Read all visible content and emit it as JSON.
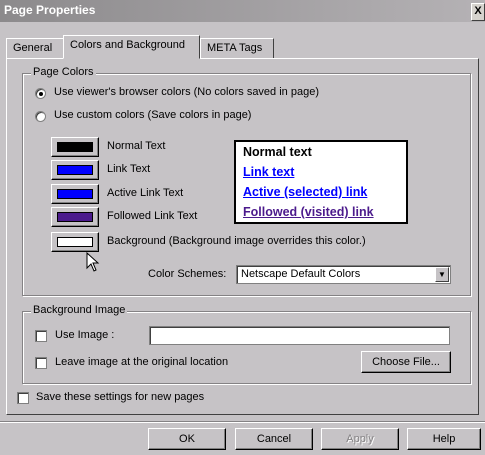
{
  "window": {
    "title": "Page Properties",
    "close_glyph": "X"
  },
  "tabs": [
    {
      "label": "General"
    },
    {
      "label": "Colors and Background"
    },
    {
      "label": "META Tags"
    }
  ],
  "page_colors": {
    "legend": "Page Colors",
    "option_browser": "Use viewer's browser colors (No colors saved in page)",
    "option_custom": "Use custom colors (Save colors in page)",
    "selected_option": "option_browser",
    "swatches": [
      {
        "label": "Normal Text",
        "color": "#000000"
      },
      {
        "label": "Link Text",
        "color": "#0000ff"
      },
      {
        "label": "Active Link Text",
        "color": "#0000ff"
      },
      {
        "label": "Followed Link Text",
        "color": "#4b1a8c"
      },
      {
        "label": "Background (Background image overrides this color.)",
        "color": "#ffffff"
      }
    ],
    "preview": {
      "normal": "Normal text",
      "link": "Link text",
      "active": "Active (selected) link",
      "followed": "Followed (visited) link"
    },
    "schemes_label": "Color Schemes:",
    "schemes_value": "Netscape Default Colors"
  },
  "background_image": {
    "legend": "Background Image",
    "use_image_label": "Use Image :",
    "use_image_value": "",
    "leave_label": "Leave image at the original location",
    "choose_file": "Choose File..."
  },
  "save_settings_label": "Save these settings for new pages",
  "buttons": {
    "ok": "OK",
    "cancel": "Cancel",
    "apply": "Apply",
    "help": "Help"
  },
  "colors": {
    "link": "#0000ff",
    "followed": "#4b1a8c"
  }
}
